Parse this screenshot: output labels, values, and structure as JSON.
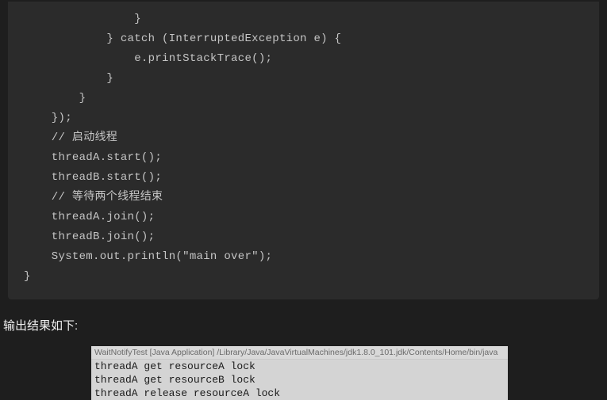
{
  "code": {
    "lines": [
      "                }",
      "            } catch (InterruptedException e) {",
      "                e.printStackTrace();",
      "            }",
      "        }",
      "    });",
      "    // 启动线程",
      "    threadA.start();",
      "    threadB.start();",
      "    // 等待两个线程结束",
      "    threadA.join();",
      "    threadB.join();",
      "    System.out.println(\"main over\");",
      "}"
    ]
  },
  "output_label": "输出结果如下:",
  "console": {
    "header": "WaitNotifyTest [Java Application] /Library/Java/JavaVirtualMachines/jdk1.8.0_101.jdk/Contents/Home/bin/java",
    "lines": [
      "threadA get resourceA lock",
      "threadA get resourceB lock",
      "threadA release resourceA lock"
    ]
  }
}
